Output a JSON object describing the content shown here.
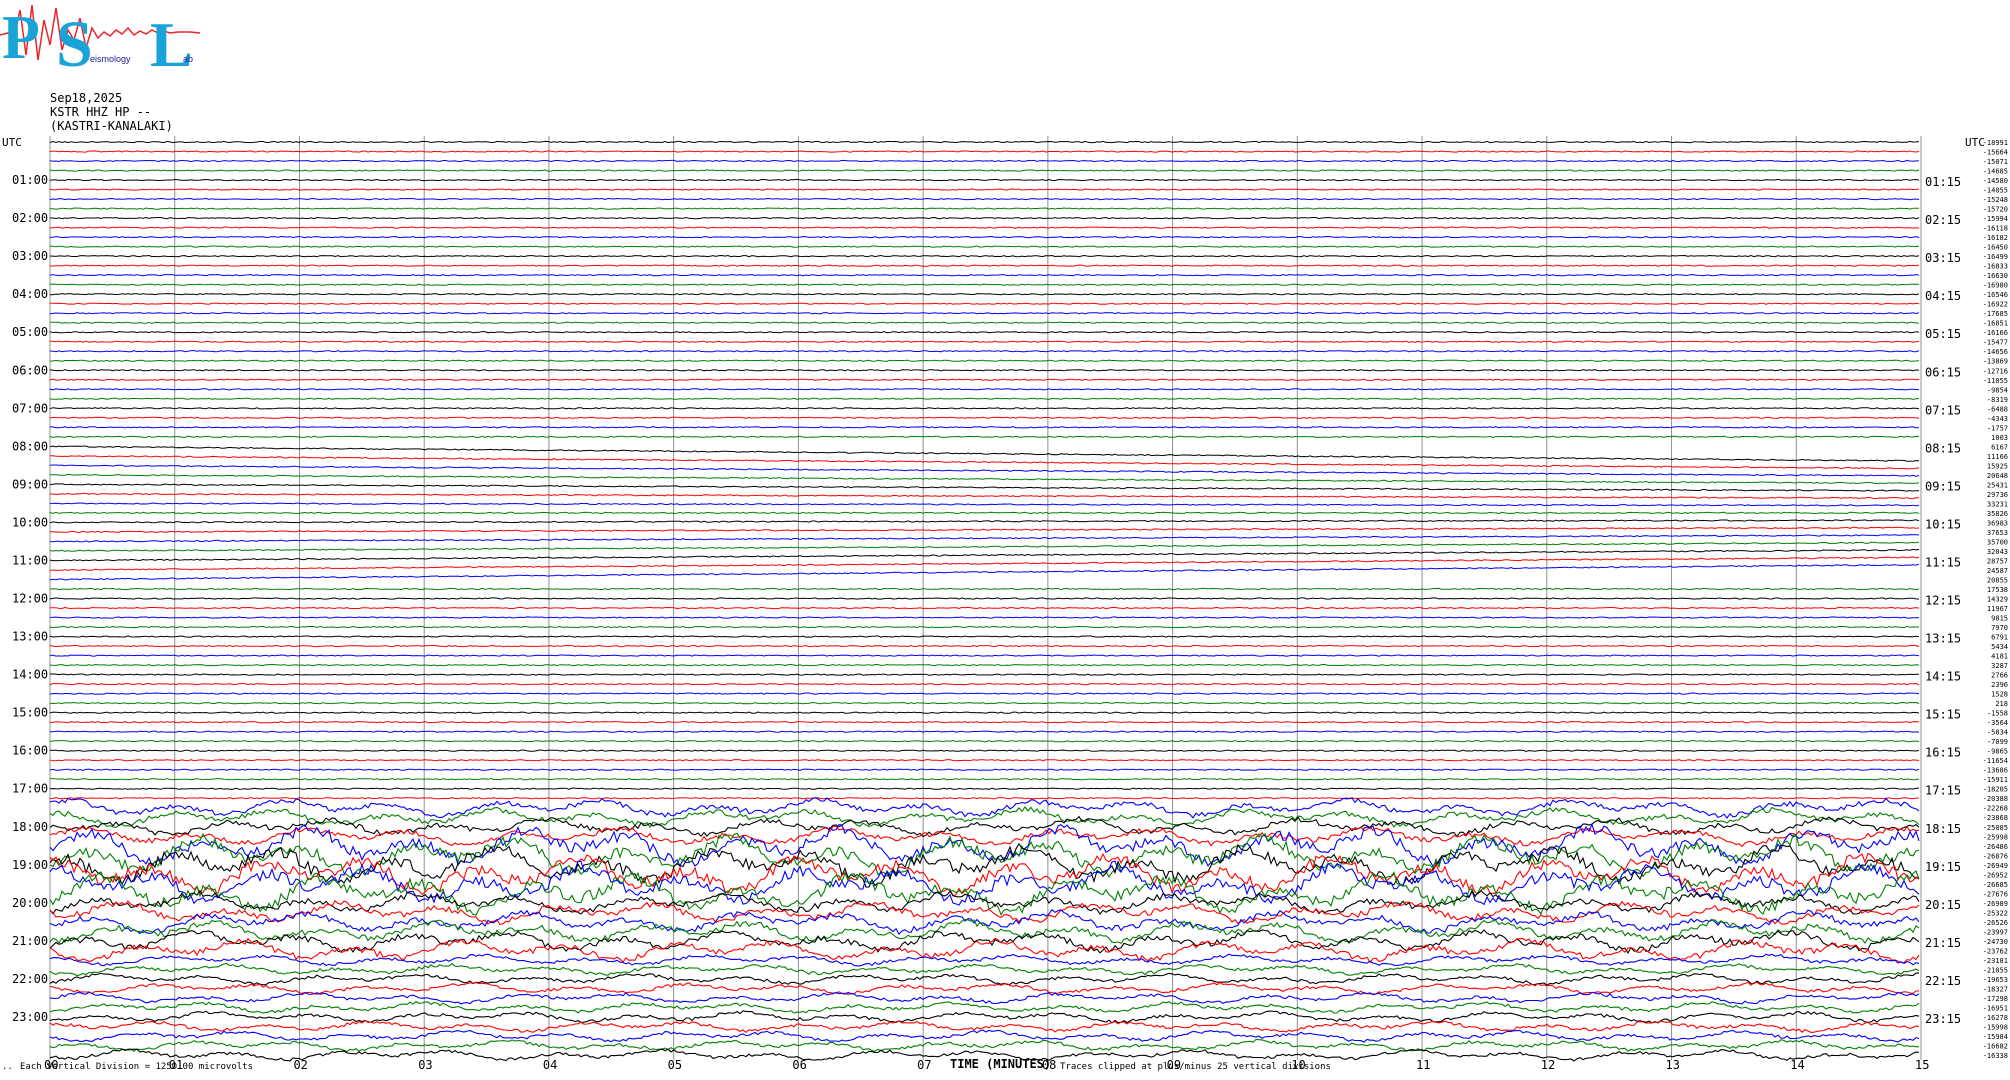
{
  "logo": {
    "letters": [
      "P",
      "S",
      "L"
    ],
    "subtitle": "eismology",
    "lab_suffix": "ab",
    "colors": {
      "letters": "#1aa3d8",
      "wave": "#e8262b"
    }
  },
  "header": {
    "date": "Sep18,2025",
    "station": "KSTR HHZ HP --",
    "location": "(KASTRI-KANALAKI)"
  },
  "footer": {
    "scale_note": "Each Vertical Division = 1250.00 microvolts",
    "x_axis_title": "TIME (MINUTES)",
    "clip_note": "Traces clipped at plus/minus 25 vertical divisions"
  },
  "chart_data": {
    "type": "line",
    "title": "",
    "xlabel": "TIME (MINUTES)",
    "ylabel": "UTC",
    "xlim": [
      0,
      15
    ],
    "x_ticks": [
      "00",
      "01",
      "02",
      "03",
      "04",
      "05",
      "06",
      "07",
      "08",
      "09",
      "10",
      "11",
      "12",
      "13",
      "14",
      "15"
    ],
    "left_axis_label": "UTC",
    "right_axis_label": "UTC",
    "left_hour_labels": [
      "01:00",
      "02:00",
      "03:00",
      "04:00",
      "05:00",
      "06:00",
      "07:00",
      "08:00",
      "09:00",
      "10:00",
      "11:00",
      "12:00",
      "13:00",
      "14:00",
      "15:00",
      "16:00",
      "17:00",
      "18:00",
      "19:00",
      "20:00",
      "21:00",
      "22:00",
      "23:00"
    ],
    "right_hour_labels": [
      "01:15",
      "02:15",
      "03:15",
      "04:15",
      "05:15",
      "06:15",
      "07:15",
      "08:15",
      "09:15",
      "10:15",
      "11:15",
      "12:15",
      "13:15",
      "14:15",
      "15:15",
      "16:15",
      "17:15",
      "18:15",
      "19:15",
      "20:15",
      "21:15",
      "22:15",
      "23:15"
    ],
    "traces_per_hour": 4,
    "trace_colors": [
      "#000000",
      "#ff0000",
      "#0000ff",
      "#008000"
    ],
    "trace_offsets": [
      -18991,
      -15664,
      -15071,
      -14685,
      -14580,
      -14055,
      -15248,
      -15720,
      -15994,
      -16118,
      -16182,
      -16450,
      -16499,
      -16833,
      -16630,
      -16980,
      -16546,
      -16922,
      -17685,
      -16851,
      -16166,
      -15477,
      -14656,
      -13869,
      -12716,
      -11055,
      -9854,
      -8319,
      -6488,
      -4343,
      -1757,
      1003,
      6167,
      11166,
      15925,
      20648,
      25431,
      29736,
      33231,
      35826,
      36983,
      37653,
      35700,
      32043,
      28757,
      24587,
      20855,
      17538,
      14329,
      11967,
      9815,
      7970,
      6791,
      5434,
      4181,
      3287,
      2766,
      2396,
      1528,
      218,
      -1558,
      -3564,
      -5834,
      -7099,
      -9865,
      -11654,
      -13686,
      -15911,
      -18205,
      -20388,
      -22268,
      -23868,
      -25085,
      -25998,
      -26486,
      -26876,
      -26949,
      -26952,
      -26685,
      -27676,
      -26989,
      -25322,
      -26526,
      -23997,
      -24730,
      -23762,
      -23181,
      -21055,
      -19653,
      -18327,
      -17298,
      -16951,
      -16278,
      -15998,
      -15984,
      -16682,
      -16338
    ],
    "scale_microvolts_per_division": 1250.0,
    "clip_divisions": 25,
    "grid": true
  }
}
